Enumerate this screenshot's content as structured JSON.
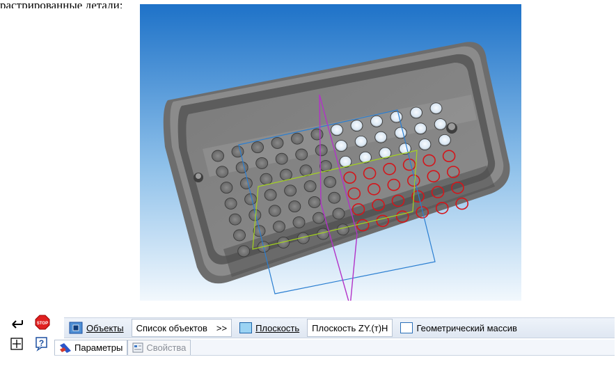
{
  "top_text": "растрированные детали:",
  "toolbar": {
    "objects_label": "Объекты",
    "object_list_label": "Список объектов",
    "object_list_arrow": ">>",
    "plane_label": "Плоскость",
    "plane_value": "Плоскость ZY.(т)Н",
    "array_label": "Геометрический массив",
    "tab_parameters": "Параметры",
    "tab_properties": "Свойства"
  },
  "colors": {
    "viewport_bg_top": "#1e72c8",
    "viewport_bg_bottom": "#f2f8fd",
    "hole_selected": "#d4161b",
    "plane_magenta": "#b232c8",
    "plane_blue": "#2a7ed1",
    "plane_green": "#a5d41e"
  },
  "icons": [
    "enter-icon",
    "stop-icon",
    "fit-view-icon",
    "help-icon",
    "objects-icon",
    "plane-icon",
    "array-checkbox-icon",
    "parameters-icon",
    "properties-icon"
  ]
}
